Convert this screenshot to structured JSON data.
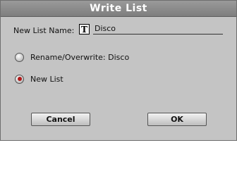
{
  "dialog": {
    "title": "Write List",
    "name_label": "New List Name:",
    "text_icon_glyph": "T",
    "name_value": "Disco",
    "options": [
      {
        "label": "Rename/Overwrite: Disco",
        "selected": false
      },
      {
        "label": "New List",
        "selected": true
      }
    ],
    "cancel_label": "Cancel",
    "ok_label": "OK"
  },
  "colors": {
    "title_bar": "#8a8a8a",
    "dialog_bg": "#c4c4c4",
    "radio_selected": "#b01818"
  }
}
